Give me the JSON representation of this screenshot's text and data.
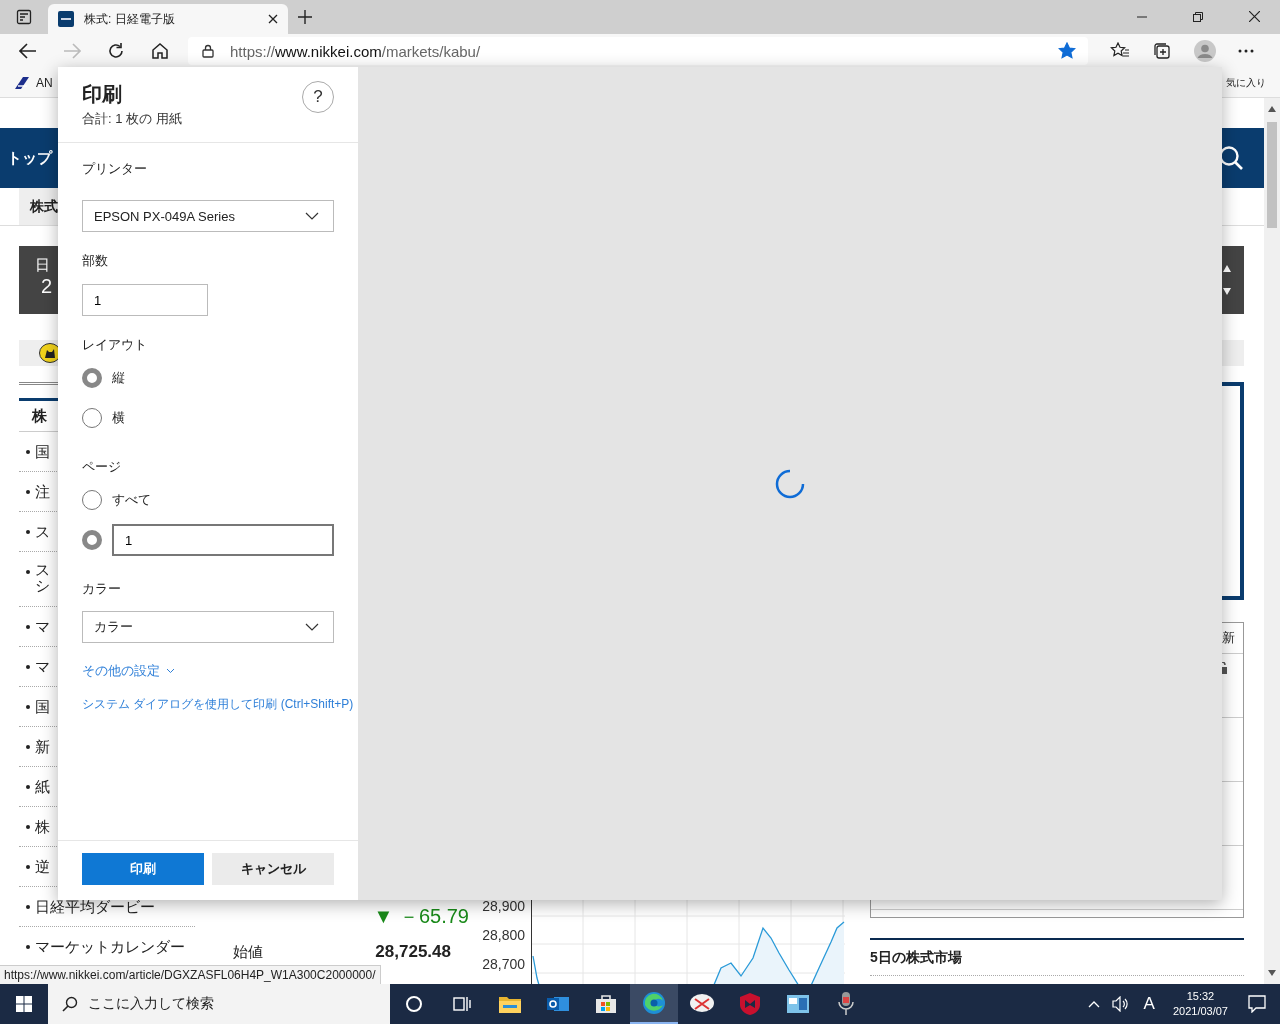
{
  "browser": {
    "tabs": [
      {
        "title": "株式: 日経電子版",
        "selected": true
      }
    ],
    "address": {
      "scheme": "https://",
      "host": "www.nikkei.com",
      "path": "/markets/kabu/"
    },
    "favorite": true,
    "bookmarks": [
      {
        "label": "AN"
      }
    ],
    "bookmarks_right": "気に入り"
  },
  "page": {
    "nav_label": "トップ",
    "sub_tab": "株式",
    "index_box": [
      "日",
      "2"
    ],
    "section_heading": "株",
    "menu": [
      {
        "lines": [
          "国"
        ]
      },
      {
        "lines": [
          "注"
        ]
      },
      {
        "lines": [
          "ス"
        ]
      },
      {
        "lines": [
          "ス",
          "シ"
        ]
      },
      {
        "lines": [
          "マ"
        ]
      },
      {
        "lines": [
          "マ"
        ]
      },
      {
        "lines": [
          "国"
        ]
      },
      {
        "lines": [
          "新"
        ]
      },
      {
        "lines": [
          "紙"
        ]
      },
      {
        "lines": [
          "株"
        ]
      },
      {
        "lines": [
          "逆"
        ]
      },
      {
        "lines": [
          "日経平均ダービー"
        ]
      },
      {
        "lines": [
          "マーケットカレンダー"
        ]
      }
    ],
    "change": "▼ －65.79",
    "open_label": "始値",
    "price": "28,725.48",
    "yticks": [
      "28,900",
      "28,800",
      "28,700"
    ],
    "table_header": "新",
    "market_heading": "5日の株式市場"
  },
  "status_url": "https://www.nikkei.com/article/DGXZASFL06H4P_W1A300C2000000/",
  "print_dialog": {
    "title": "印刷",
    "summary": "合計: 1 枚の 用紙",
    "help": "?",
    "printer": {
      "label": "プリンター",
      "value": "EPSON PX-049A Series"
    },
    "copies": {
      "label": "部数",
      "value": "1"
    },
    "layout": {
      "label": "レイアウト",
      "options": [
        {
          "label": "縦",
          "selected": true
        },
        {
          "label": "横",
          "selected": false
        }
      ]
    },
    "pages": {
      "label": "ページ",
      "options": [
        {
          "kind": "text",
          "label": "すべて",
          "selected": false
        },
        {
          "kind": "input",
          "value": "1",
          "selected": true
        }
      ]
    },
    "color": {
      "label": "カラー",
      "value": "カラー"
    },
    "more_settings": "その他の設定",
    "system_dialog": "システム ダイアログを使用して印刷 (Ctrl+Shift+P)",
    "buttons": [
      {
        "label": "印刷",
        "kind": "primary"
      },
      {
        "label": "キャンセル",
        "kind": "secondary"
      }
    ]
  },
  "taskbar": {
    "search_placeholder": "ここに入力して検索",
    "apps": [
      {
        "kind": "cortana",
        "selected": false
      },
      {
        "kind": "taskview",
        "selected": false
      },
      {
        "kind": "folder",
        "selected": false
      },
      {
        "kind": "mail",
        "selected": false
      },
      {
        "kind": "store",
        "selected": false
      },
      {
        "kind": "browser",
        "selected": true
      },
      {
        "kind": "scissors",
        "selected": false
      },
      {
        "kind": "shield",
        "selected": false
      },
      {
        "kind": "window",
        "selected": false
      },
      {
        "kind": "mic",
        "selected": false
      }
    ],
    "ime": "A",
    "time": "15:32",
    "date": "2021/03/07"
  }
}
